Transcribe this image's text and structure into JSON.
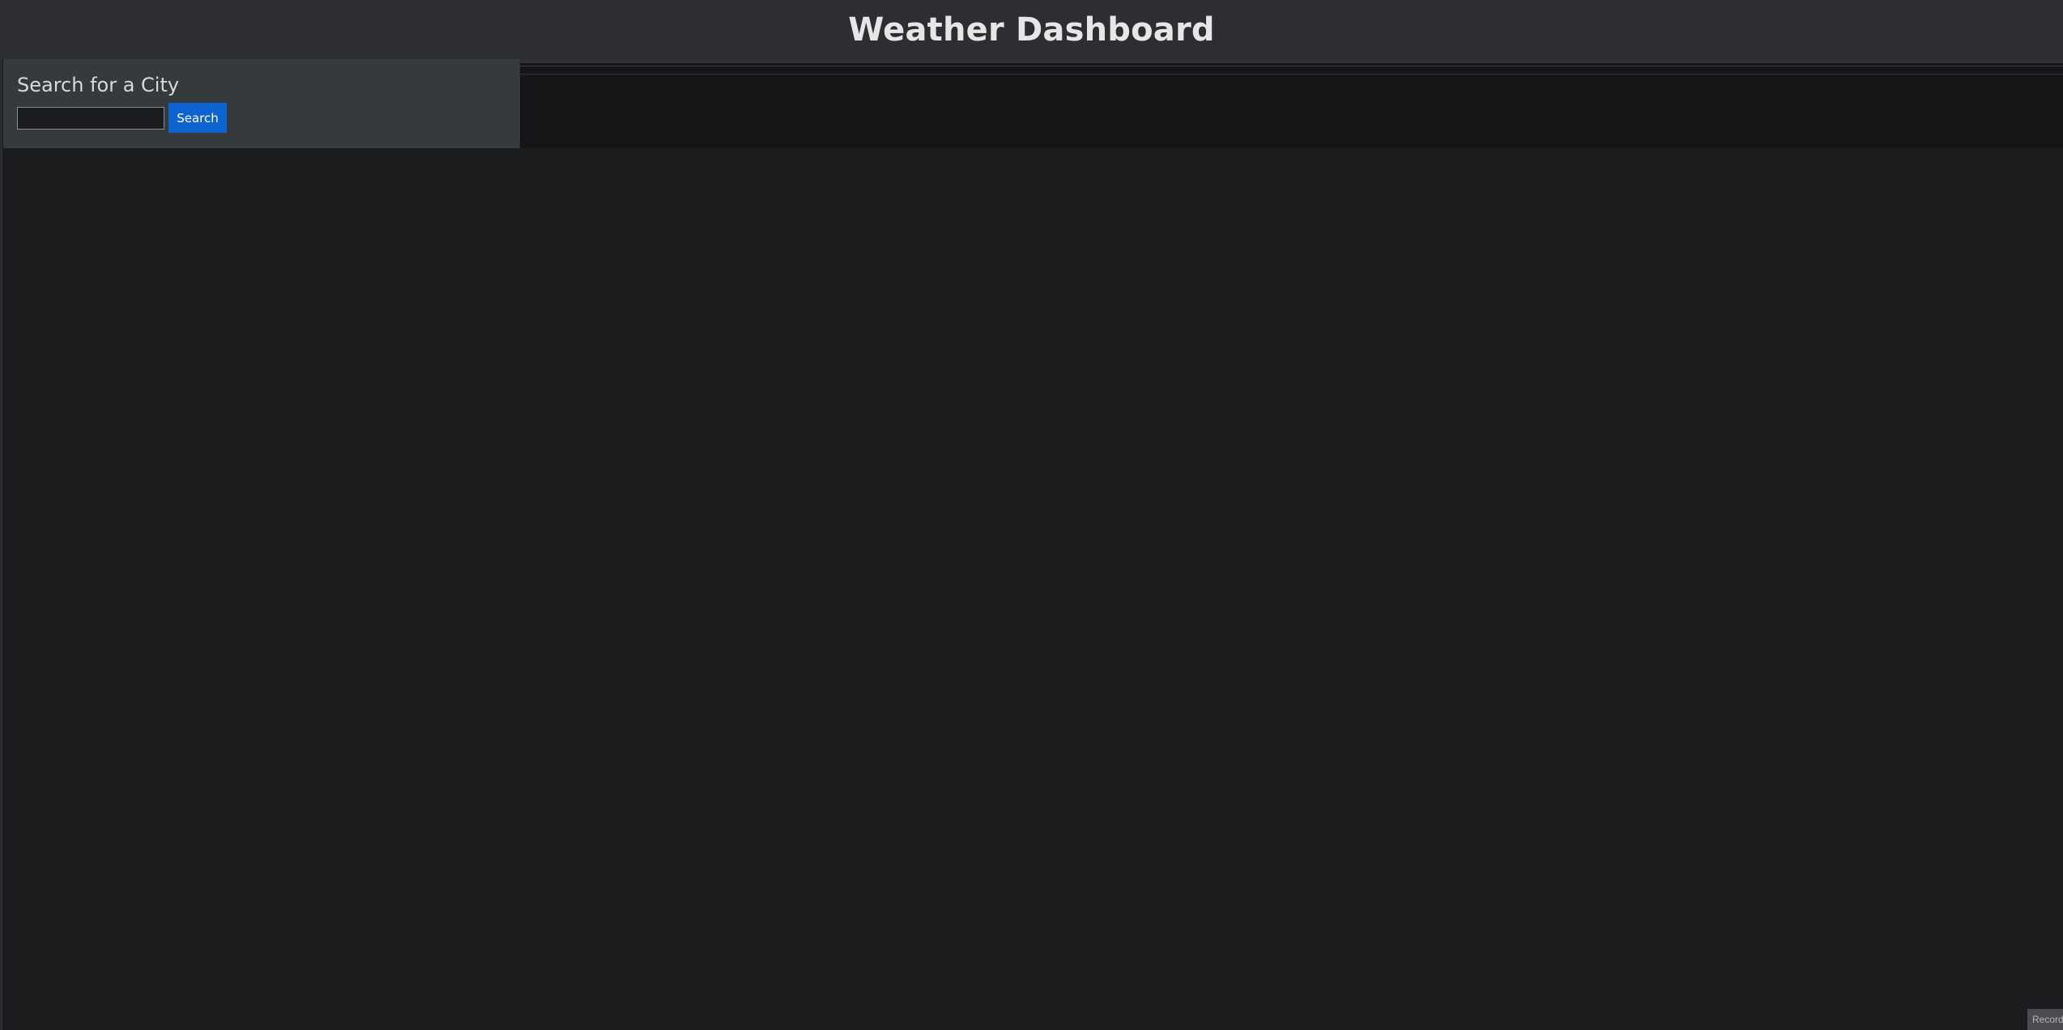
{
  "header": {
    "title": "Weather Dashboard"
  },
  "sidebar": {
    "heading": "Search for a City",
    "search_input_value": "",
    "search_button_label": "Search"
  },
  "main": {
    "forecast_text": ""
  },
  "record_tab": {
    "label": "Record"
  },
  "colors": {
    "background": "#1b1c1e",
    "header_bg": "#2c2e32",
    "sidebar_bg": "#353a3d",
    "button_accent": "#0d63d0"
  }
}
